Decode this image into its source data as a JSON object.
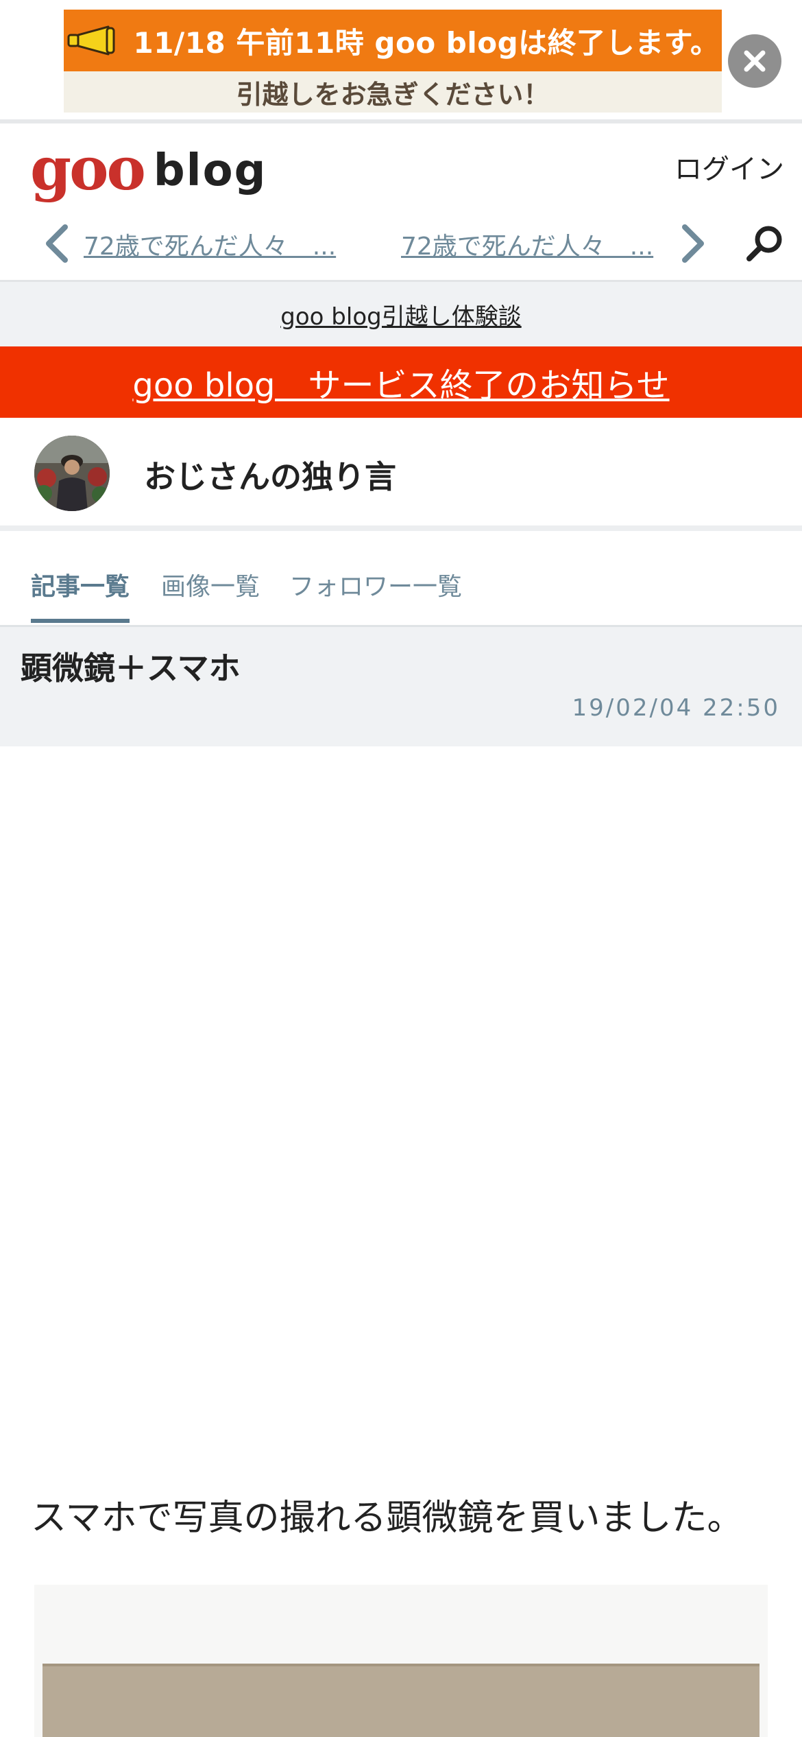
{
  "banner": {
    "line1": "11/18 午前11時 goo blogは終了します。",
    "line2": "引越しをお急ぎください！",
    "close_icon": "close-icon",
    "colors": {
      "top": "#f07a12",
      "bottom": "#f3f0e6"
    }
  },
  "header": {
    "logo_goo": "goo",
    "logo_blog": "blog",
    "login": "ログイン",
    "nav": {
      "prev_link": "72歳で死んだ人々　...",
      "next_link": "72歳で死んだ人々　...",
      "prev_icon": "chevron-left-icon",
      "next_icon": "chevron-right-icon",
      "search_icon": "search-icon"
    }
  },
  "story_link": "goo blog引越し体験談",
  "notice": {
    "text": "goo blog　サービス終了のお知らせ",
    "color": "#f03100"
  },
  "blog": {
    "title": "おじさんの独り言"
  },
  "tabs": [
    {
      "label": "記事一覧",
      "active": true
    },
    {
      "label": "画像一覧",
      "active": false
    },
    {
      "label": "フォロワー一覧",
      "active": false
    }
  ],
  "article": {
    "title": "顕微鏡＋スマホ",
    "date": "19/02/04 22:50",
    "body": "スマホで写真の撮れる顕微鏡を買いました。"
  }
}
